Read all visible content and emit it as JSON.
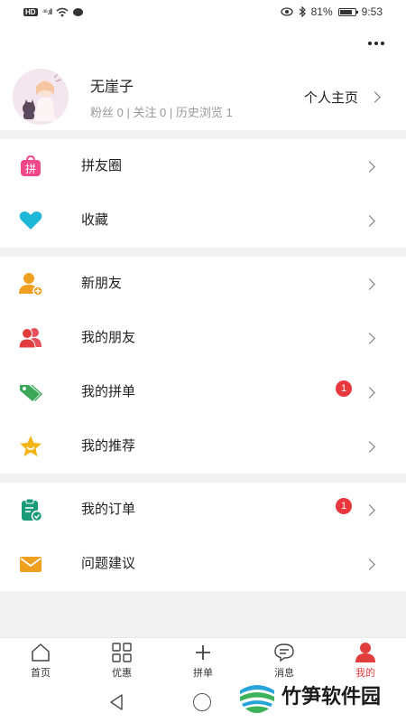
{
  "status_bar": {
    "hd": "HD",
    "signal": "⁴⁶.ıll",
    "battery_pct": "81%",
    "time": "9:53"
  },
  "profile": {
    "username": "无崖子",
    "stats": "粉丝 0 | 关注 0 | 历史浏览 1",
    "homepage_label": "个人主页"
  },
  "sections": [
    {
      "items": [
        {
          "label": "拼友圈",
          "icon": "pin-bag-icon"
        },
        {
          "label": "收藏",
          "icon": "heart-icon"
        }
      ]
    },
    {
      "items": [
        {
          "label": "新朋友",
          "icon": "add-friend-icon"
        },
        {
          "label": "我的朋友",
          "icon": "friends-icon"
        },
        {
          "label": "我的拼单",
          "icon": "tag-icon",
          "badge": "1"
        },
        {
          "label": "我的推荐",
          "icon": "star-icon"
        }
      ]
    },
    {
      "items": [
        {
          "label": "我的订单",
          "icon": "order-clipboard-icon",
          "badge": "1"
        },
        {
          "label": "问题建议",
          "icon": "mail-icon"
        }
      ]
    }
  ],
  "icon_text": {
    "pin_char": "拼"
  },
  "tab_bar": {
    "tabs": [
      {
        "label": "首页",
        "icon": "home-icon"
      },
      {
        "label": "优惠",
        "icon": "grid-icon"
      },
      {
        "label": "拼单",
        "icon": "plus-icon"
      },
      {
        "label": "消息",
        "icon": "message-icon"
      },
      {
        "label": "我的",
        "icon": "user-icon",
        "active": true
      }
    ]
  },
  "watermark": {
    "text": "竹笋软件园"
  },
  "colors": {
    "accent_red": "#e23d3d",
    "badge_red": "#e8383d",
    "pink": "#f0488a",
    "cyan": "#1fb7d8",
    "orange": "#f0a020",
    "green": "#1a9b78",
    "tag_green": "#3aa657",
    "yellow": "#f3b518"
  }
}
